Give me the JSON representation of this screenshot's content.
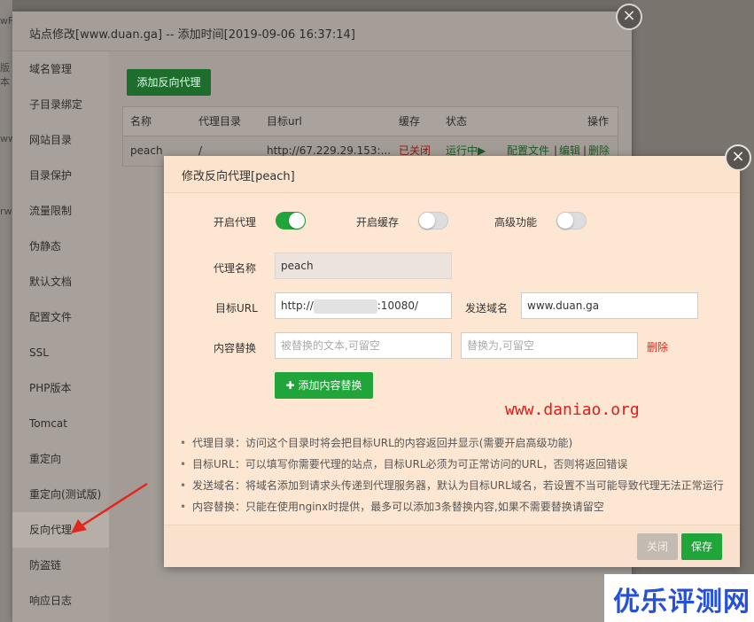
{
  "background": {
    "left_fragments": [
      "wF",
      "版本",
      "ww",
      "rw"
    ]
  },
  "outer_dialog": {
    "title": "站点修改[www.duan.ga] -- 添加时间[2019-09-06 16:37:14]",
    "close_glyph": "×",
    "sidebar": [
      "域名管理",
      "子目录绑定",
      "网站目录",
      "目录保护",
      "流量限制",
      "伪静态",
      "默认文档",
      "配置文件",
      "SSL",
      "PHP版本",
      "Tomcat",
      "重定向",
      "重定向(测试版)",
      "反向代理",
      "防盗链",
      "响应日志"
    ],
    "active_item": "反向代理",
    "add_button": "添加反向代理",
    "table": {
      "headers": [
        "名称",
        "代理目录",
        "目标url",
        "缓存",
        "状态",
        "操作"
      ],
      "row": {
        "name": "peach",
        "dir": "/",
        "url": "http://67.229.29.153:...",
        "cache": "已关闭",
        "status": "运行中▶",
        "action_config": "配置文件",
        "sep": "|",
        "action_edit": "编辑",
        "action_delete": "删除"
      }
    }
  },
  "modal": {
    "title": "修改反向代理[peach]",
    "close_glyph": "×",
    "toggles": [
      {
        "label": "开启代理",
        "on": true
      },
      {
        "label": "开启缓存",
        "on": false
      },
      {
        "label": "高级功能",
        "on": false
      }
    ],
    "proxy_name": {
      "label": "代理名称",
      "value": "peach"
    },
    "target_url": {
      "label": "目标URL",
      "value_prefix": "http://",
      "value_suffix": ":10080/"
    },
    "send_domain": {
      "label": "发送域名",
      "value": "www.duan.ga"
    },
    "content_replace": {
      "label": "内容替换",
      "placeholder_from": "被替换的文本,可留空",
      "placeholder_to": "替换为,可留空",
      "delete_label": "删除",
      "add_button": "添加内容替换",
      "add_icon": "plus-icon"
    },
    "tips": [
      "代理目录：访问这个目录时将会把目标URL的内容返回并显示(需要开启高级功能)",
      "目标URL：可以填写你需要代理的站点，目标URL必须为可正常访问的URL，否则将返回错误",
      "发送域名：将域名添加到请求头传递到代理服务器，默认为目标URL域名，若设置不当可能导致代理无法正常运行",
      "内容替换：只能在使用nginx时提供，最多可以添加3条替换内容,如果不需要替换请留空"
    ],
    "footer": {
      "close_label": "关闭",
      "save_label": "保存"
    }
  },
  "overlay": {
    "watermark": "www.daniao.org",
    "logo_text": "优乐评测网",
    "arrow_color": "#e0281e"
  }
}
